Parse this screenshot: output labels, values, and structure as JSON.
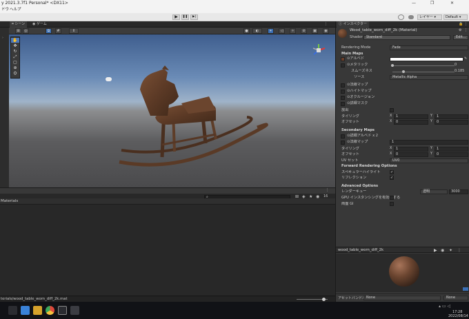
{
  "window": {
    "title": "y 2021.3.7f1 Personal* <DX11>",
    "controls": [
      "—",
      "❐",
      "✕"
    ]
  },
  "menu": {
    "items": [
      "ドウ",
      "ヘルプ"
    ]
  },
  "toolbar": {
    "play": "▶",
    "pause": "❚❚",
    "step": "▶|",
    "layers": "レイヤー",
    "layout": "Default",
    "cloud_icon": "cloud-icon",
    "history_icon": "history-icon",
    "search_icon": "search-icon"
  },
  "scene_tabs": {
    "scene": "シーン",
    "game": "ゲーム"
  },
  "scene_view": {
    "grid_number": "10"
  },
  "bottom": {
    "folder_title": "Materials",
    "search_placeholder": "",
    "count": "16",
    "status_path": "terials/wood_table_worn_diff_2k.mat"
  },
  "inspector": {
    "tab": "インスペクター",
    "title": "Wood_table_worn_diff_2k (Material)",
    "shader_label": "Shader",
    "shader_value": "Standard",
    "edit_label": "Edit...",
    "rendering_mode_label": "Rendering Mode",
    "rendering_mode_value": "Fade",
    "main_maps": "Main Maps",
    "albedo": "アルベド",
    "metallic": "メタリック",
    "metallic_value": "0",
    "smoothness": "スムーズネス",
    "smoothness_value": "0.185",
    "source": "ソース",
    "source_value": "Metallic Alpha",
    "normal": "法線マップ",
    "height": "ハイトマップ",
    "occlusion": "オクルージョン",
    "detail_mask": "詳細マスク",
    "emission": "放出",
    "tiling": "タイリング",
    "offset": "オフセット",
    "tiling_x": "1",
    "tiling_y": "1",
    "offset_x": "0",
    "offset_y": "0",
    "secondary_maps": "Secondary Maps",
    "detail_albedo": "詳細アルベド x 2",
    "detail_normal": "法線マップ",
    "detail_normal_value": "1",
    "sec_tiling_x": "1",
    "sec_tiling_y": "1",
    "sec_offset_x": "0",
    "sec_offset_y": "0",
    "uv_set": "UV セット",
    "uv_value": "UV0",
    "forward_options": "Forward Rendering Options",
    "specular": "スペキュラーハイライト",
    "reflections": "リフレクション",
    "advanced": "Advanced Options",
    "render_queue": "レンダーキュー",
    "render_queue_mode": "透明",
    "render_queue_value": "3000",
    "gpu_instancing": "GPU インスタンシングを有効にする",
    "double_sided_gi": "両面 GI",
    "preview_title": "wood_table_worn_diff_2k",
    "asset_bundle": "アセットバンドル",
    "asset_bundle_value": "None",
    "asset_bundle_variant": "None",
    "x_label": "X",
    "y_label": "Y"
  },
  "taskbar": {
    "time": "17:28",
    "date": "2022/08/14"
  }
}
